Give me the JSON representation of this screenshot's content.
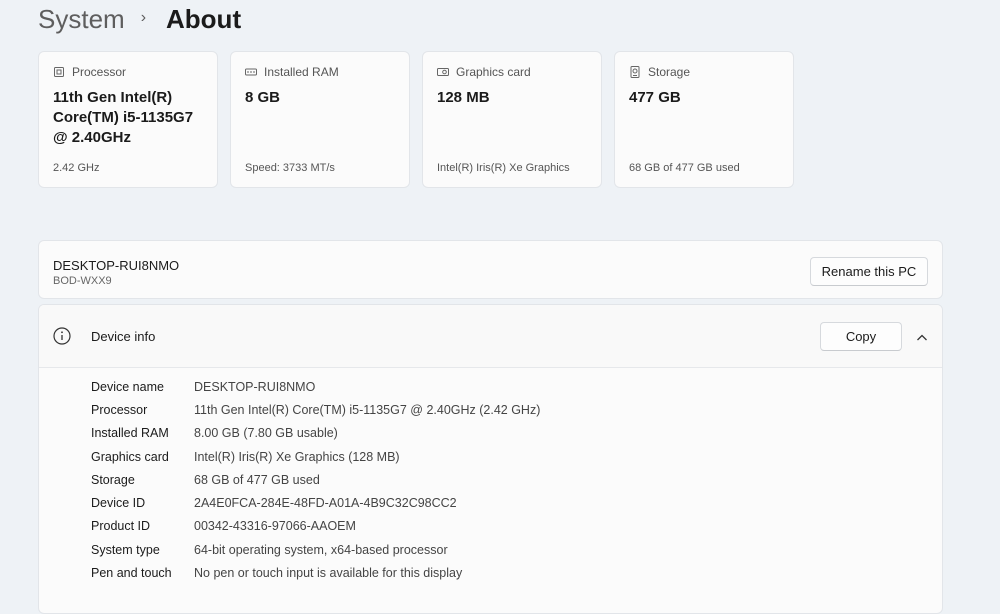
{
  "breadcrumb": {
    "parent": "System",
    "separator": "›",
    "current": "About"
  },
  "cards": [
    {
      "icon": "processor-icon",
      "label": "Processor",
      "value": "11th Gen Intel(R) Core(TM) i5-1135G7 @ 2.40GHz",
      "sub": "2.42 GHz"
    },
    {
      "icon": "ram-icon",
      "label": "Installed RAM",
      "value": "8 GB",
      "sub": "Speed: 3733 MT/s"
    },
    {
      "icon": "graphics-card-icon",
      "label": "Graphics card",
      "value": "128 MB",
      "sub": "Intel(R) Iris(R) Xe Graphics"
    },
    {
      "icon": "storage-icon",
      "label": "Storage",
      "value": "477 GB",
      "sub": "68 GB of 477 GB used"
    }
  ],
  "pc": {
    "name": "DESKTOP-RUI8NMO",
    "model": "BOD-WXX9",
    "rename_label": "Rename this PC"
  },
  "device_info": {
    "title": "Device info",
    "copy_label": "Copy",
    "specs": [
      {
        "label": "Device name",
        "value": "DESKTOP-RUI8NMO"
      },
      {
        "label": "Processor",
        "value": "11th Gen Intel(R) Core(TM) i5-1135G7 @ 2.40GHz (2.42 GHz)"
      },
      {
        "label": "Installed RAM",
        "value": "8.00 GB (7.80 GB usable)"
      },
      {
        "label": "Graphics card",
        "value": "Intel(R) Iris(R) Xe Graphics (128 MB)"
      },
      {
        "label": "Storage",
        "value": "68 GB of 477 GB used"
      },
      {
        "label": "Device ID",
        "value": "2A4E0FCA-284E-48FD-A01A-4B9C32C98CC2"
      },
      {
        "label": "Product ID",
        "value": "00342-43316-97066-AAOEM"
      },
      {
        "label": "System type",
        "value": "64-bit operating system, x64-based processor"
      },
      {
        "label": "Pen and touch",
        "value": "No pen or touch input is available for this display"
      }
    ]
  },
  "colors": {
    "background": "#eef2f6",
    "card": "#fbfbfb",
    "border": "#e2e5e9"
  }
}
